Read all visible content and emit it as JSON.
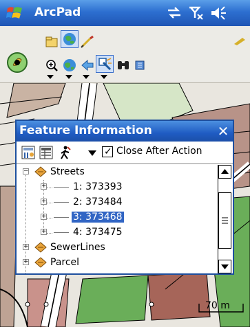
{
  "app": {
    "title": "ArcPad"
  },
  "statusbar": {
    "icons": [
      "connectivity-icon",
      "signal-off-icon",
      "speaker-icon"
    ]
  },
  "toolbar": {
    "row1": [
      "open-map-icon",
      "layers-icon",
      "edit-icon"
    ],
    "row2": [
      "zoom-in-icon",
      "globe-icon",
      "back-icon",
      "identify-icon",
      "find-icon",
      "scroll-icon"
    ],
    "selected": "identify-icon"
  },
  "map": {
    "scale_label": "70 m"
  },
  "dialog": {
    "title": "Feature Information",
    "close_label": "✕",
    "close_after_action": {
      "label": "Close After Action",
      "checked": true
    },
    "tree": {
      "root": "Streets",
      "children": [
        "1: 373393",
        "2: 373484",
        "3: 373468",
        "4: 373475"
      ],
      "selected_child": "3: 373468",
      "siblings": [
        "SewerLines",
        "Parcel"
      ]
    }
  },
  "colors": {
    "titlebar": "#2d6fd0",
    "selection": "#3165c4",
    "parcel_green": "#5ea452",
    "parcel_red": "#b35c55",
    "road": "#ffffff",
    "lawn": "#c9ddb7"
  }
}
